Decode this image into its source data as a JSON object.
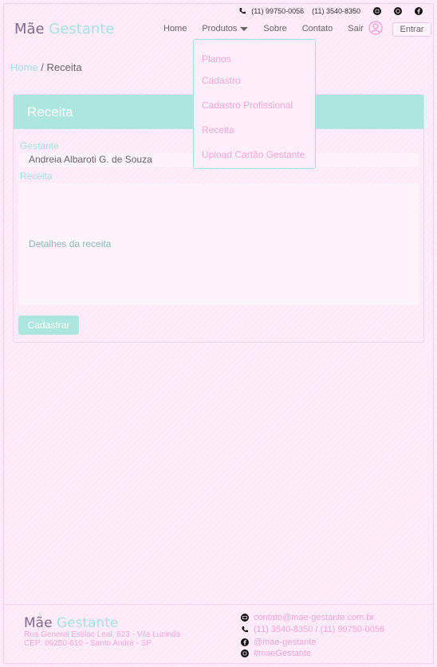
{
  "topbar": {
    "phone1": "(11) 99750-0056",
    "phone2": "(11) 3540-8350"
  },
  "brand": {
    "part1": "Mãe",
    "part2": "Gestante"
  },
  "nav": {
    "home": "Home",
    "produtos": "Produtos",
    "sobre": "Sobre",
    "contato": "Contato",
    "sair": "Sair",
    "entrar": "Entrar"
  },
  "dropdown": {
    "items": [
      "Planos",
      "Cadastro",
      "Cadastro Profissional",
      "Receita",
      "Upload Cartão Gestante"
    ]
  },
  "breadcrumb": {
    "home": "Home",
    "current": " / Receita"
  },
  "card": {
    "title": "Receita",
    "gestante_label": "Gestante",
    "gestante_value": "Andreia Albaroti G. de Souza",
    "receita_label": "Receita",
    "receita_placeholder": "Detalhes da receita",
    "submit": "Cadastrar"
  },
  "footer": {
    "brand1": "Mãe",
    "brand2": "Gestante",
    "address1": "Rua General Estilac Leal, 623 - Vila Lucinda",
    "address2": "CEP: 09250-610 - Santo André - SP",
    "email": "contato@mae-gestante.com.br",
    "phones": "(11) 3540-8350 / (11) 99750-0056",
    "facebook": "@mae-gestante",
    "instagram": "#maeGestante"
  },
  "colors": {
    "accent": "#ade5df",
    "pink": "#f6a6d8",
    "background": "#fde9f7"
  }
}
